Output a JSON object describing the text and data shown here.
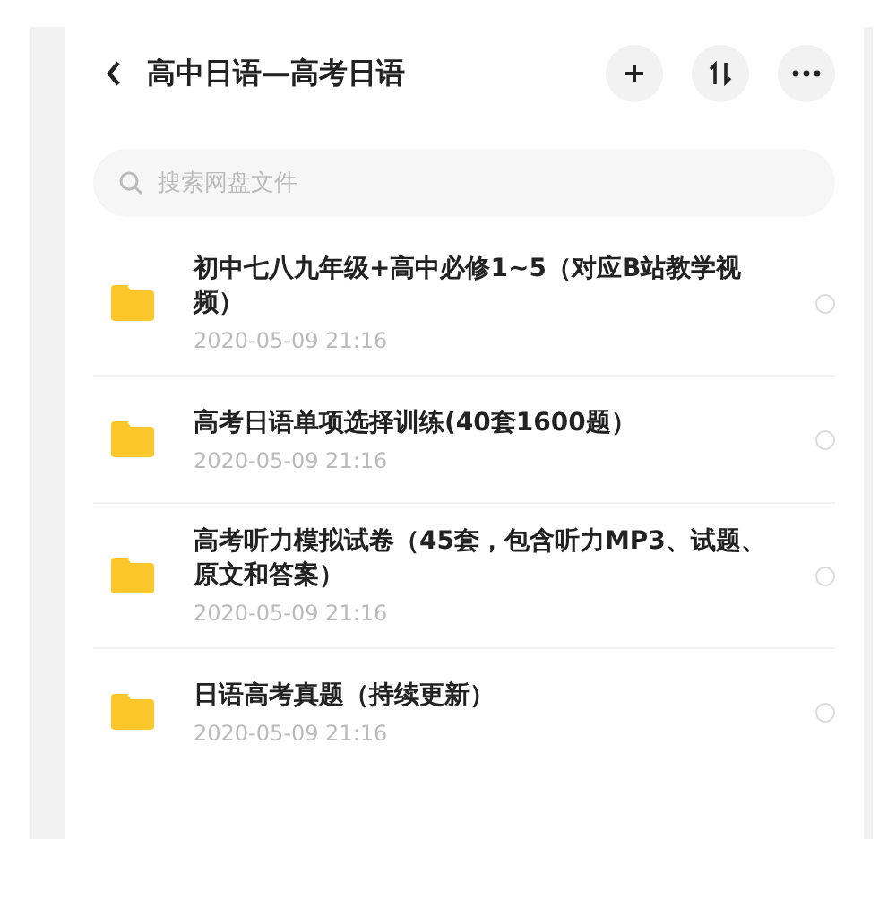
{
  "header": {
    "title": "高中日语—高考日语"
  },
  "search": {
    "placeholder": "搜索网盘文件"
  },
  "files": [
    {
      "name": "初中七八九年级+高中必修1~5（对应B站教学视频）",
      "date": "2020-05-09  21:16",
      "selected": false
    },
    {
      "name": "高考日语单项选择训练(40套1600题）",
      "date": "2020-05-09  21:16",
      "selected": false
    },
    {
      "name": "高考听力模拟试卷（45套，包含听力MP3、试题、原文和答案）",
      "date": "2020-05-09  21:16",
      "selected": false
    },
    {
      "name": "日语高考真题（持续更新）",
      "date": "2020-05-09  21:16",
      "selected": false
    }
  ]
}
